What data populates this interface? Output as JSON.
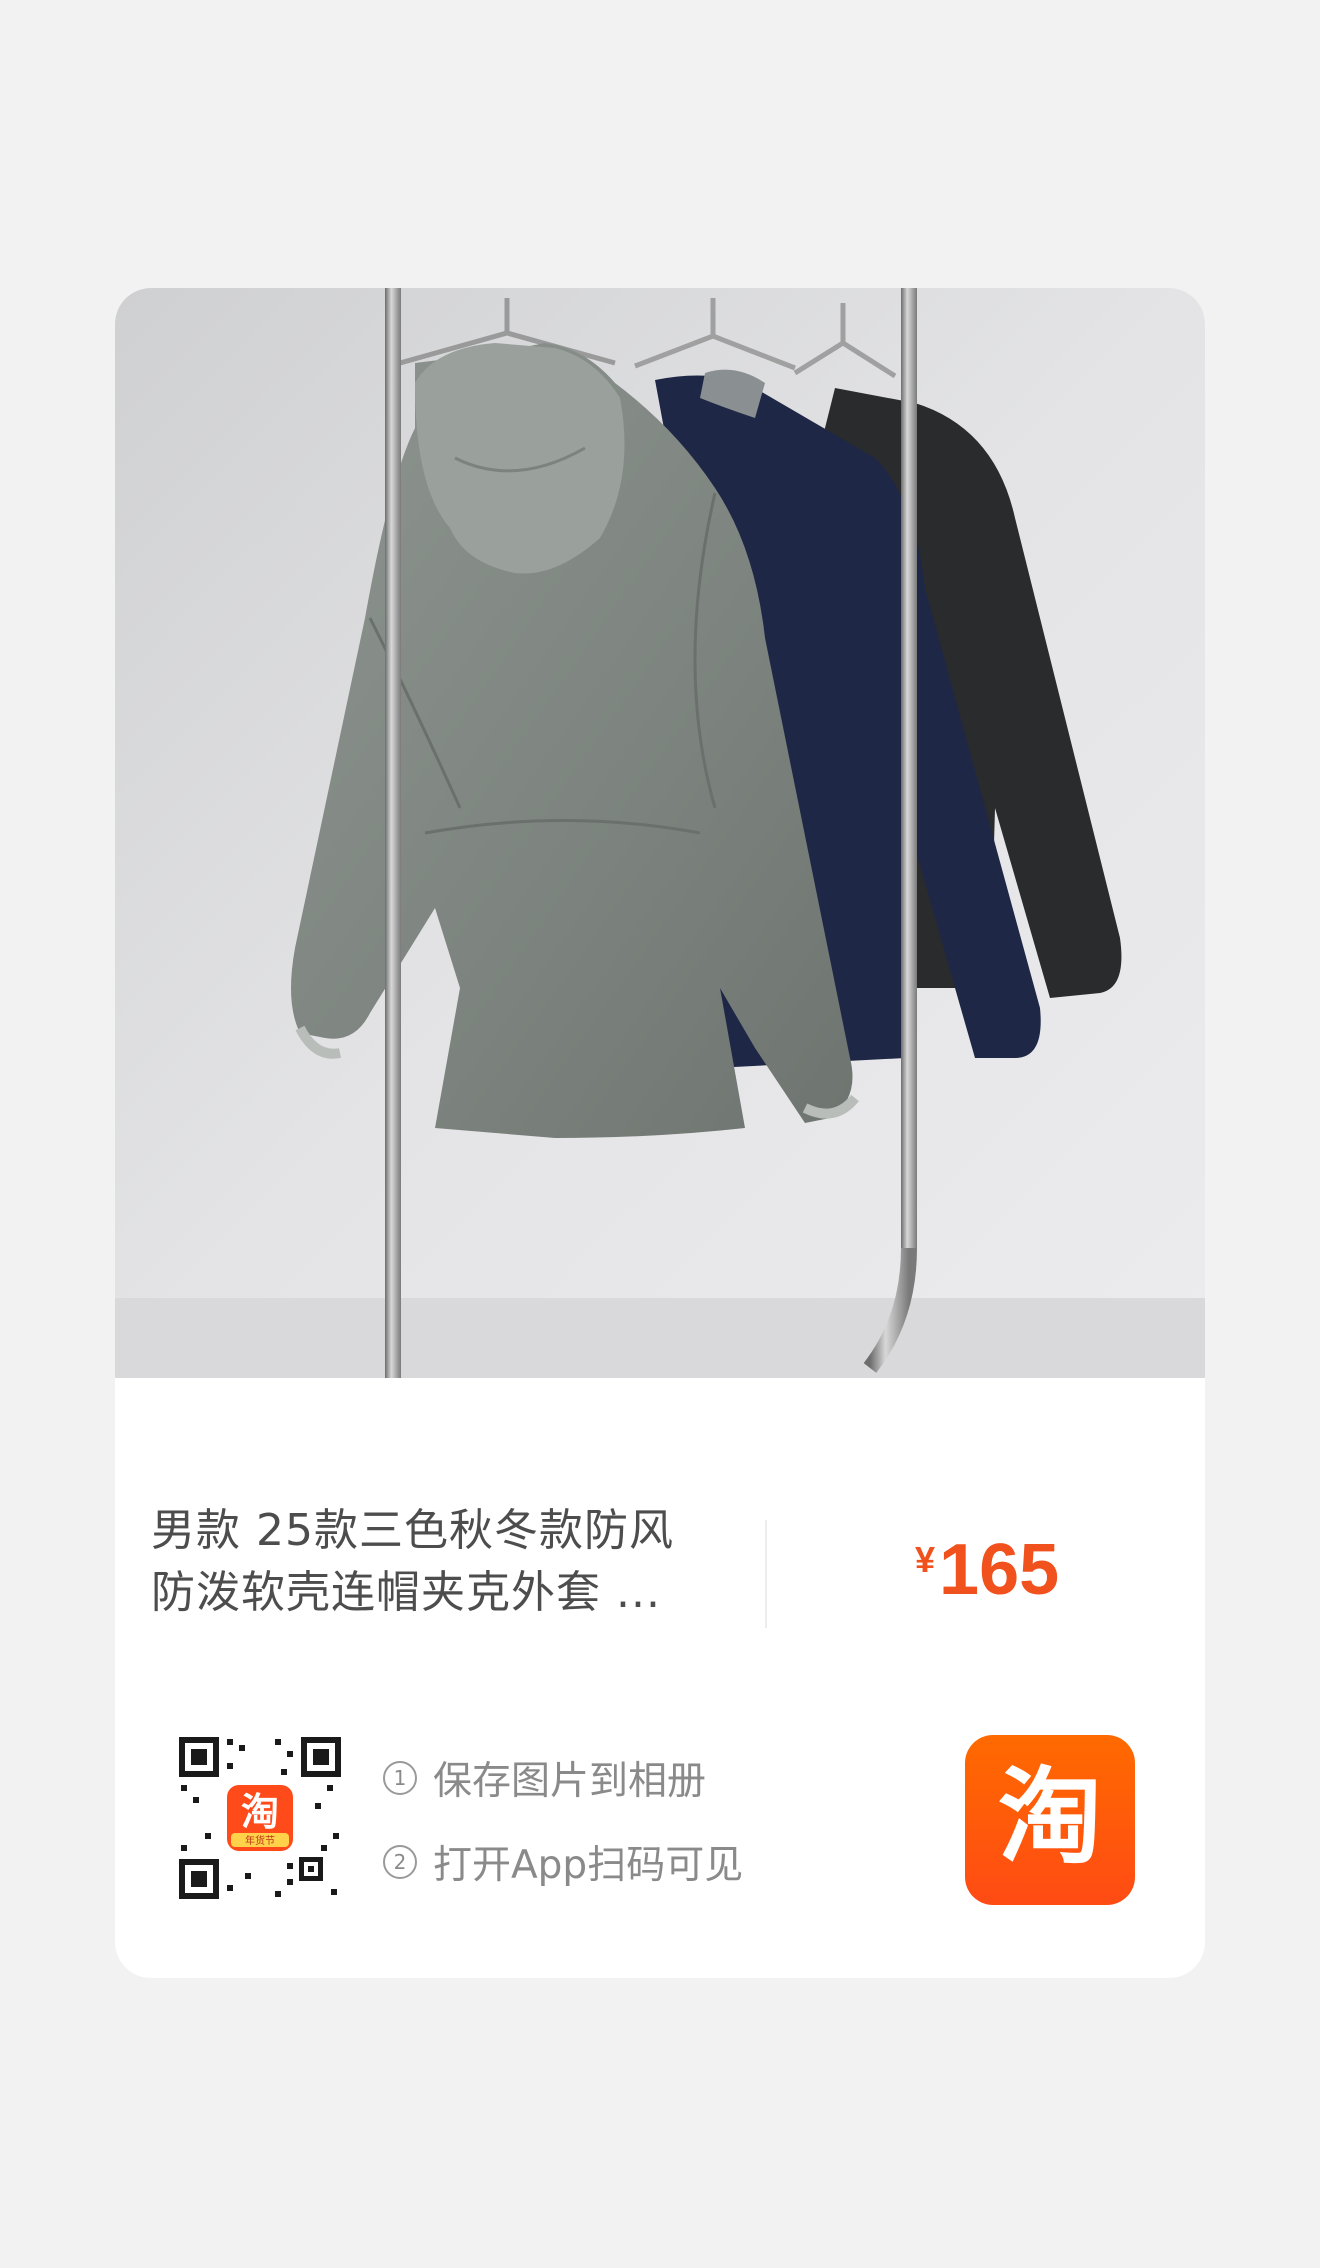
{
  "product": {
    "title": "男款 25款三色秋冬款防风\n防泼软壳连帽夹克外套 ...",
    "currency_symbol": "¥",
    "price": "165",
    "image": "product-photo-jackets"
  },
  "share": {
    "qr_badge_text": "淘",
    "qr_badge_sub": "年货节",
    "steps": [
      {
        "num": "1",
        "text": "保存图片到相册"
      },
      {
        "num": "2",
        "text": "打开App扫码可见"
      }
    ]
  },
  "app_icon": {
    "glyph": "淘",
    "name": "taobao-icon"
  },
  "colors": {
    "background": "#f2f2f2",
    "card": "#ffffff",
    "price": "#f0511d",
    "brand_orange": "#ff5a00",
    "text_title": "#4d4d4d",
    "text_muted": "#8a8a8a"
  }
}
